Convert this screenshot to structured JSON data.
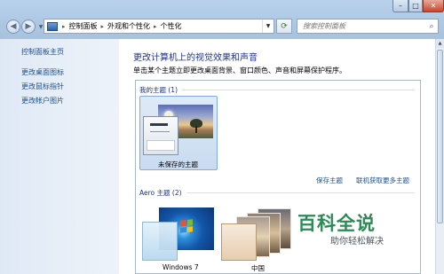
{
  "breadcrumb": [
    "控制面板",
    "外观和个性化",
    "个性化"
  ],
  "search": {
    "placeholder": "搜索控制面板"
  },
  "sidebar": {
    "items": [
      {
        "label": "控制面板主页"
      },
      {
        "label": "更改桌面图标"
      },
      {
        "label": "更改鼠标指针"
      },
      {
        "label": "更改帐户图片"
      }
    ]
  },
  "main": {
    "title": "更改计算机上的视觉效果和声音",
    "description": "单击某个主题立即更改桌面背景、窗口颜色、声音和屏幕保护程序。",
    "my_themes": {
      "header": "我的主题 (1)",
      "themes": [
        {
          "label": "未保存的主题",
          "selected": true
        }
      ],
      "save_link": "保存主题",
      "online_link": "联机获取更多主题"
    },
    "aero_themes": {
      "header": "Aero 主题 (2)",
      "themes": [
        {
          "label": "Windows 7"
        },
        {
          "label": "中国"
        }
      ]
    }
  },
  "watermark": {
    "title": "百科全说",
    "subtitle": "助你轻松解决"
  },
  "colors": {
    "accent": "#1e3287",
    "link": "#1f4f8c",
    "watermark": "#2c8a55"
  }
}
